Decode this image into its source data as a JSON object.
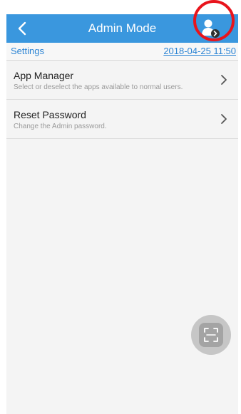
{
  "header": {
    "title": "Admin Mode",
    "back_icon": "chevron-left-icon",
    "admin_icon": "user-settings-icon",
    "bar_color": "#3a97de",
    "highlight_color": "#e8141c"
  },
  "subheader": {
    "settings_label": "Settings",
    "date_text": "2018-04-25 11:50"
  },
  "list": {
    "items": [
      {
        "title": "App Manager",
        "description": "Select or deselect the apps available to normal users.",
        "icon": "chevron-right-icon"
      },
      {
        "title": "Reset Password",
        "description": "Change the Admin password.",
        "icon": "chevron-right-icon"
      }
    ]
  },
  "fab": {
    "icon": "scan-icon"
  }
}
